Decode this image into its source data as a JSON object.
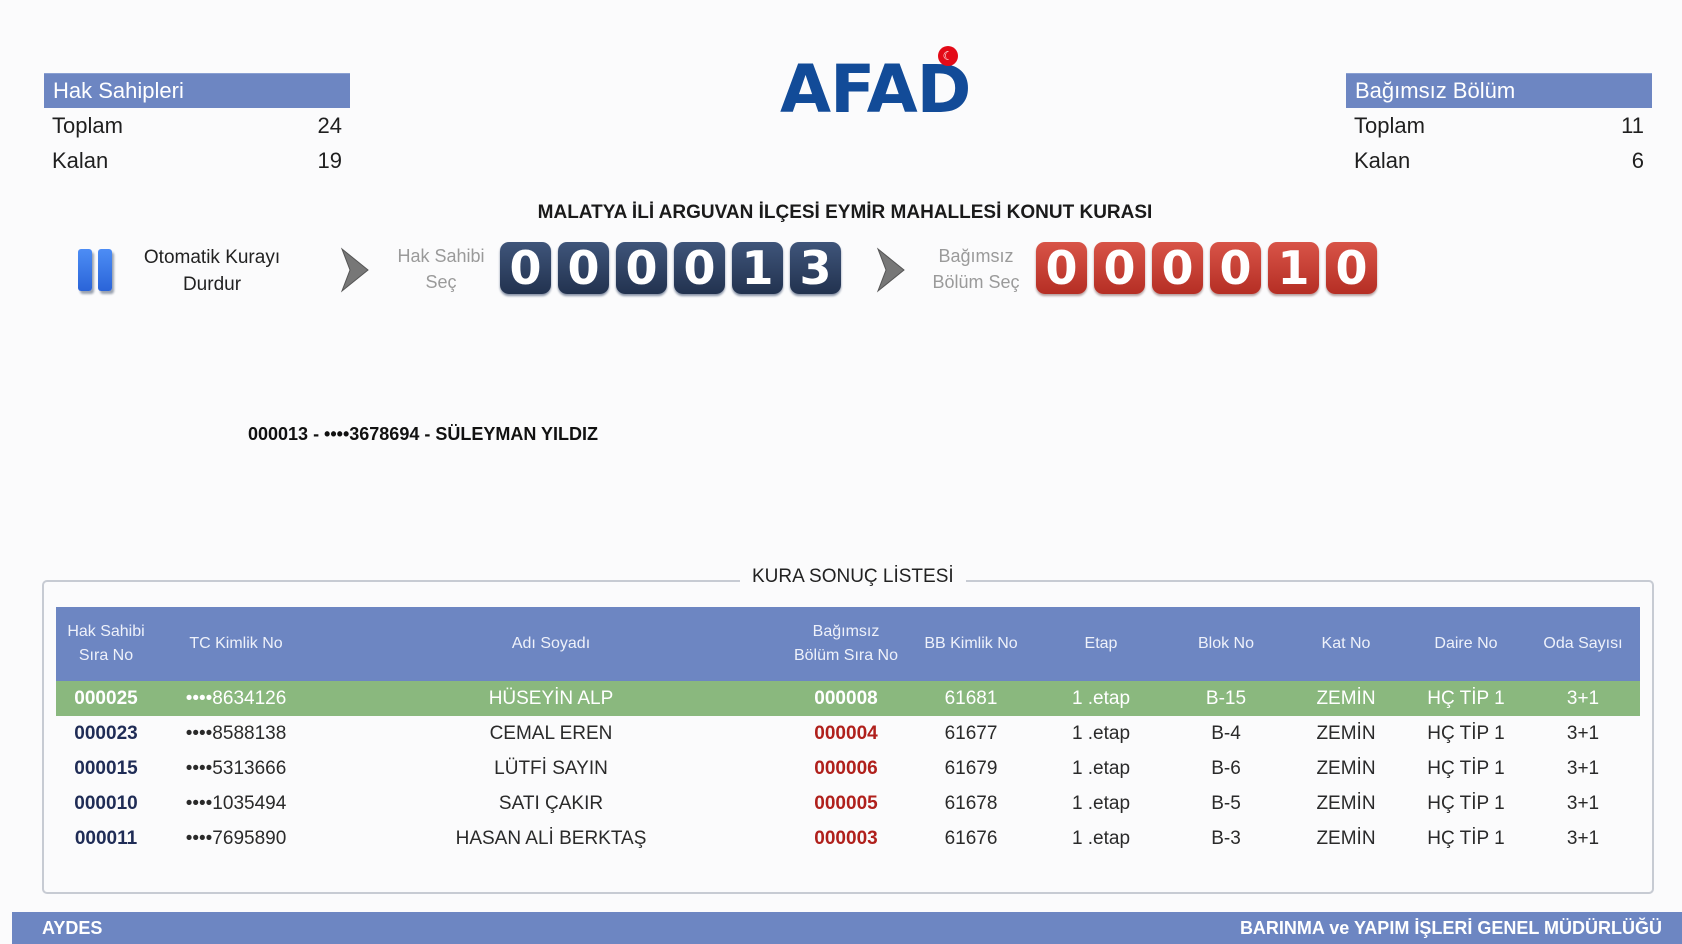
{
  "logo": {
    "text": "AFAD"
  },
  "left_panel": {
    "title": "Hak Sahipleri",
    "rows": [
      {
        "label": "Toplam",
        "value": "24"
      },
      {
        "label": "Kalan",
        "value": "19"
      }
    ]
  },
  "right_panel": {
    "title": "Bağımsız Bölüm",
    "rows": [
      {
        "label": "Toplam",
        "value": "11"
      },
      {
        "label": "Kalan",
        "value": "6"
      }
    ]
  },
  "title": "MALATYA İLİ ARGUVAN İLÇESİ EYMİR MAHALLESİ KONUT KURASI",
  "controls": {
    "pause_label_1": "Otomatik Kurayı",
    "pause_label_2": "Durdur",
    "step1_label_1": "Hak Sahibi",
    "step1_label_2": "Seç",
    "step2_label_1": "Bağımsız",
    "step2_label_2": "Bölüm Seç"
  },
  "counters": {
    "hak_sahibi": [
      "0",
      "0",
      "0",
      "0",
      "1",
      "3"
    ],
    "bagimsiz_bolum": [
      "0",
      "0",
      "0",
      "0",
      "1",
      "0"
    ]
  },
  "current_selection": "000013 - ••••3678694 - SÜLEYMAN YILDIZ",
  "results": {
    "title": "KURA SONUÇ LİSTESİ",
    "headers": [
      "Hak Sahibi Sıra No",
      "TC Kimlik No",
      "Adı Soyadı",
      "Bağımsız Bölüm Sıra No",
      "BB Kimlik No",
      "Etap",
      "Blok No",
      "Kat No",
      "Daire No",
      "Oda Sayısı"
    ],
    "rows": [
      [
        "000025",
        "••••8634126",
        "HÜSEYİN ALP",
        "000008",
        "61681",
        "1 .etap",
        "B-15",
        "ZEMİN",
        "HÇ TİP 1",
        "3+1"
      ],
      [
        "000023",
        "••••8588138",
        "CEMAL EREN",
        "000004",
        "61677",
        "1 .etap",
        "B-4",
        "ZEMİN",
        "HÇ TİP 1",
        "3+1"
      ],
      [
        "000015",
        "••••5313666",
        "LÜTFİ SAYIN",
        "000006",
        "61679",
        "1 .etap",
        "B-6",
        "ZEMİN",
        "HÇ TİP 1",
        "3+1"
      ],
      [
        "000010",
        "••••1035494",
        "SATI ÇAKIR",
        "000005",
        "61678",
        "1 .etap",
        "B-5",
        "ZEMİN",
        "HÇ TİP 1",
        "3+1"
      ],
      [
        "000011",
        "••••7695890",
        "HASAN ALİ BERKTAŞ",
        "000003",
        "61676",
        "1 .etap",
        "B-3",
        "ZEMİN",
        "HÇ TİP 1",
        "3+1"
      ]
    ]
  },
  "footer": {
    "left": "AYDES",
    "right": "BARINMA ve YAPIM İŞLERİ GENEL MÜDÜRLÜĞÜ"
  },
  "colors": {
    "header_blue": "#6d86c2",
    "highlight_green": "#8ab87e",
    "counter_blue": "#2b3b5c",
    "counter_red": "#c73b30"
  }
}
